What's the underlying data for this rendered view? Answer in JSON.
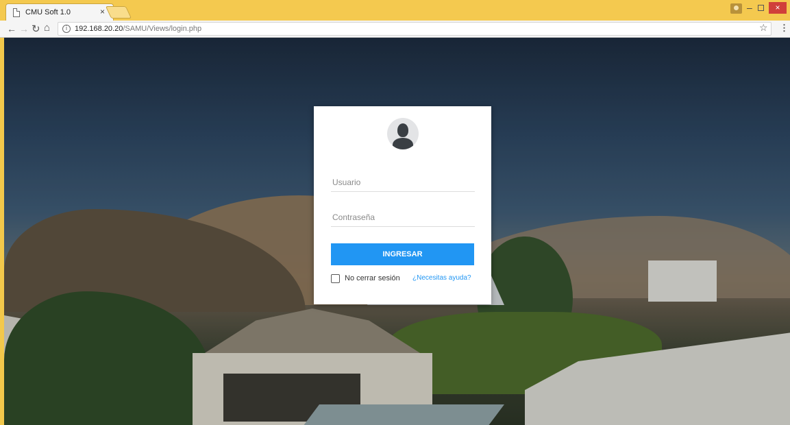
{
  "browser": {
    "tab_title": "CMU Soft 1.0",
    "tab_close": "×",
    "url_host": "192.168.20.20",
    "url_path": "/SAMU/Views/login.php",
    "info_glyph": "i",
    "icons": {
      "back": "back-arrow-icon",
      "forward": "forward-arrow-icon",
      "reload": "reload-icon",
      "home": "home-icon",
      "star": "star-icon",
      "menu": "menu-dots-icon"
    },
    "window_controls": {
      "minimize": "–",
      "close": "×"
    }
  },
  "login": {
    "username_placeholder": "Usuario",
    "password_placeholder": "Contraseña",
    "submit_label": "INGRESAR",
    "remember_label": "No cerrar sesión",
    "help_link": "¿Necesitas ayuda?"
  },
  "colors": {
    "accent": "#2196f3",
    "titlebar": "#f4c94f",
    "close_button": "#d0403a"
  }
}
